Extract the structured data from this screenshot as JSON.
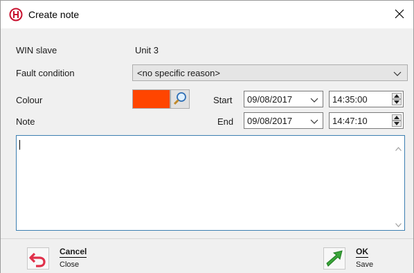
{
  "window": {
    "title": "Create note",
    "app_icon": "resistor-logo-icon",
    "close_icon": "close-icon"
  },
  "form": {
    "win_slave_label": "WIN slave",
    "win_slave_value": "Unit 3",
    "fault_condition_label": "Fault condition",
    "fault_condition_value": "<no specific reason>",
    "colour_label": "Colour",
    "colour_value": "#ff4500",
    "note_label": "Note",
    "start_label": "Start",
    "start_date": "09/08/2017",
    "start_time": "14:35:00",
    "end_label": "End",
    "end_date": "09/08/2017",
    "end_time": "14:47:10",
    "note_text": ""
  },
  "footer": {
    "cancel_label": "Cancel",
    "cancel_sub": "Close",
    "ok_label": "OK",
    "ok_sub": "Save"
  },
  "colors": {
    "accent_red": "#c8102e",
    "focus_border": "#3c7fb1",
    "ok_green": "#3aa53a"
  }
}
